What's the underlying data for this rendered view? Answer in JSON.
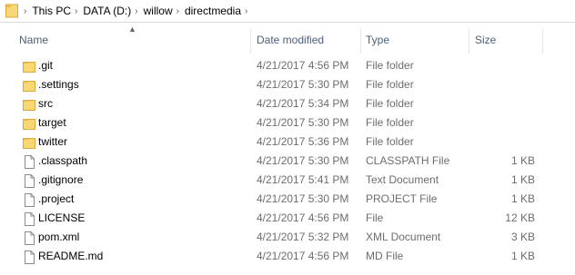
{
  "breadcrumb": [
    "This PC",
    "DATA (D:)",
    "willow",
    "directmedia"
  ],
  "columns": {
    "name": "Name",
    "date": "Date modified",
    "type": "Type",
    "size": "Size"
  },
  "files": [
    {
      "name": ".git",
      "date": "4/21/2017 4:56 PM",
      "type": "File folder",
      "size": "",
      "icon": "folder-icon"
    },
    {
      "name": ".settings",
      "date": "4/21/2017 5:30 PM",
      "type": "File folder",
      "size": "",
      "icon": "folder-icon"
    },
    {
      "name": "src",
      "date": "4/21/2017 5:34 PM",
      "type": "File folder",
      "size": "",
      "icon": "folder-icon"
    },
    {
      "name": "target",
      "date": "4/21/2017 5:30 PM",
      "type": "File folder",
      "size": "",
      "icon": "folder-icon"
    },
    {
      "name": "twitter",
      "date": "4/21/2017 5:36 PM",
      "type": "File folder",
      "size": "",
      "icon": "folder-icon"
    },
    {
      "name": ".classpath",
      "date": "4/21/2017 5:30 PM",
      "type": "CLASSPATH File",
      "size": "1 KB",
      "icon": "file-icon"
    },
    {
      "name": ".gitignore",
      "date": "4/21/2017 5:41 PM",
      "type": "Text Document",
      "size": "1 KB",
      "icon": "file-icon"
    },
    {
      "name": ".project",
      "date": "4/21/2017 5:30 PM",
      "type": "PROJECT File",
      "size": "1 KB",
      "icon": "file-icon"
    },
    {
      "name": "LICENSE",
      "date": "4/21/2017 4:56 PM",
      "type": "File",
      "size": "12 KB",
      "icon": "file-icon"
    },
    {
      "name": "pom.xml",
      "date": "4/21/2017 5:32 PM",
      "type": "XML Document",
      "size": "3 KB",
      "icon": "file-icon"
    },
    {
      "name": "README.md",
      "date": "4/21/2017 4:56 PM",
      "type": "MD File",
      "size": "1 KB",
      "icon": "file-icon"
    }
  ],
  "colors": {
    "folder": "#f8d775",
    "folder_dark": "#e8b84a",
    "header_text": "#4c607a",
    "meta_text": "#6d6d6d"
  }
}
